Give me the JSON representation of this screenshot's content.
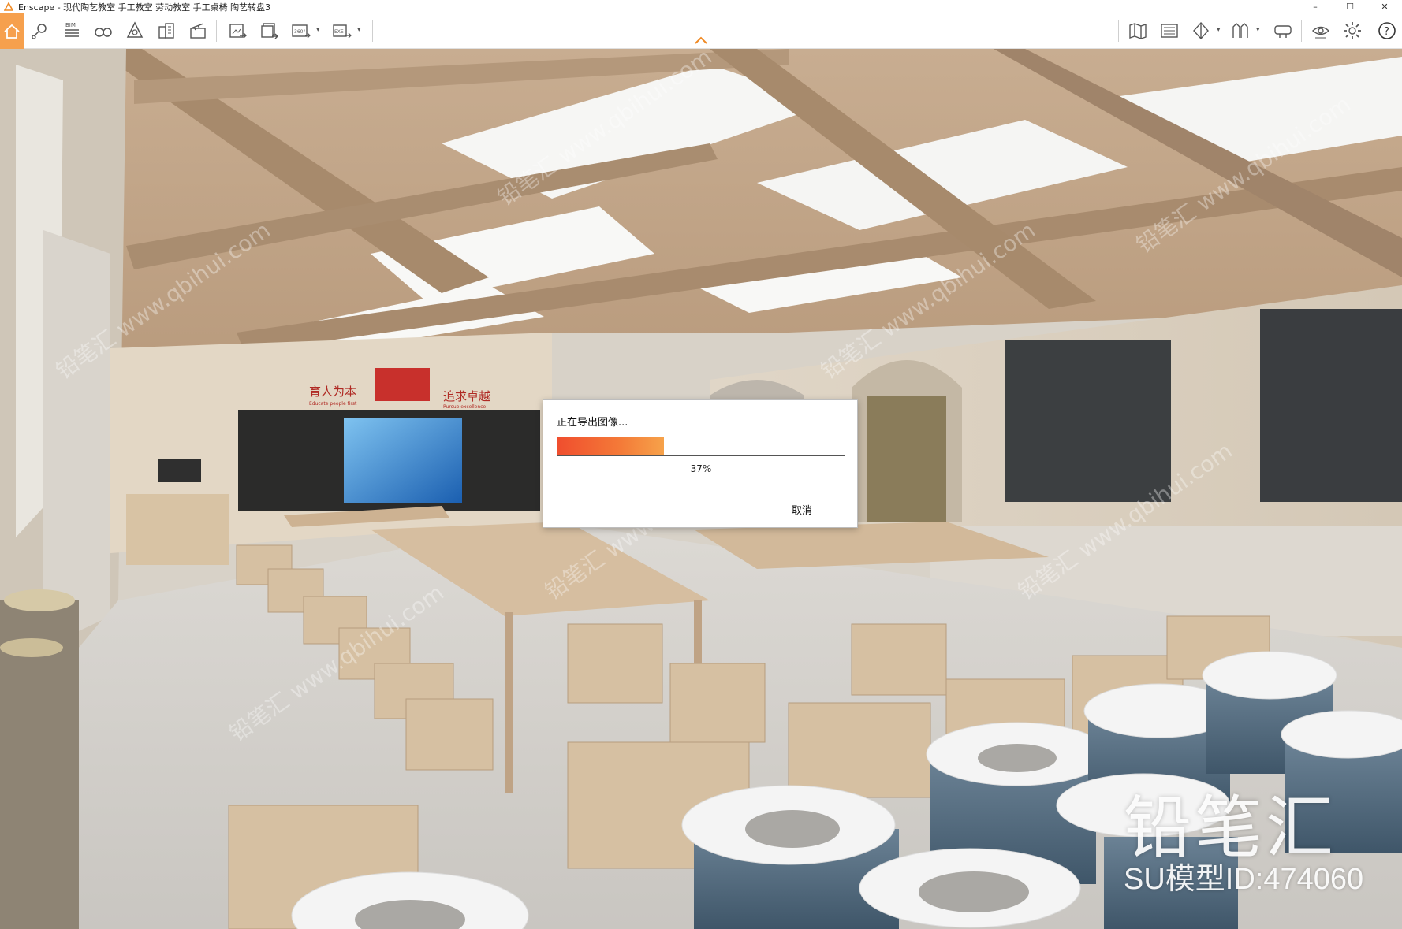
{
  "window": {
    "app_name": "Enscape",
    "title": "Enscape - 现代陶艺教室 手工教室 劳动教室 手工桌椅 陶艺转盘3",
    "controls": {
      "minimize": "–",
      "maximize": "☐",
      "close": "✕"
    }
  },
  "toolbar": {
    "left_buttons": [
      {
        "name": "home-icon"
      },
      {
        "name": "view-management-icon"
      },
      {
        "name": "bim-icon",
        "label": "BIM"
      },
      {
        "name": "binoculars-icon"
      },
      {
        "name": "asset-library-icon"
      },
      {
        "name": "material-editor-icon"
      },
      {
        "name": "video-editor-icon"
      },
      {
        "name": "export-image-icon"
      },
      {
        "name": "batch-render-icon"
      },
      {
        "name": "panorama-360-icon",
        "label": "360°"
      },
      {
        "name": "export-exe-icon",
        "label": "EXE"
      }
    ],
    "right_buttons": [
      {
        "name": "map-icon"
      },
      {
        "name": "atmosphere-icon"
      },
      {
        "name": "visual-settings-icon"
      },
      {
        "name": "collaboration-icon"
      },
      {
        "name": "vr-headset-icon"
      },
      {
        "name": "view-toggle-icon"
      },
      {
        "name": "settings-gear-icon"
      },
      {
        "name": "help-icon"
      }
    ],
    "collapse_icon": "chevron-up-icon",
    "accent_color": "#f6a04d"
  },
  "scene": {
    "signs": {
      "left_sign": "育人为本",
      "left_sign_sub": "Educate people first",
      "right_sign": "追求卓越",
      "right_sign_sub": "Pursue excellence"
    },
    "watermark": {
      "brand": "铅笔汇",
      "model_id": "SU模型ID:474060",
      "tile_text": "铅笔汇 www.qbihui.com"
    }
  },
  "export_dialog": {
    "title": "正在导出图像...",
    "progress_percent": 37,
    "progress_label": "37%",
    "cancel_label": "取消",
    "progress_colors": [
      "#f04e2e",
      "#f6a24a"
    ]
  }
}
